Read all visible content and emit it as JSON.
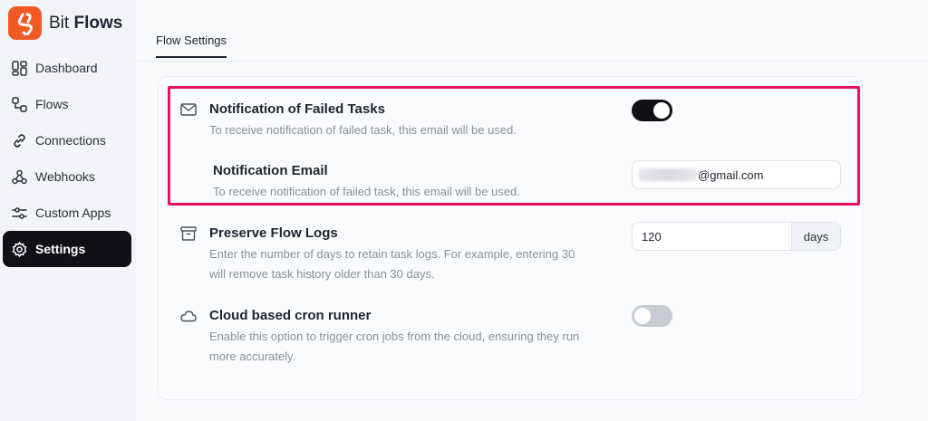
{
  "brand": {
    "name_light": "Bit",
    "name_bold": "Flows",
    "color": "#f15a24"
  },
  "sidebar": {
    "items": [
      {
        "label": "Dashboard",
        "icon": "dashboard-icon",
        "active": false
      },
      {
        "label": "Flows",
        "icon": "flows-icon",
        "active": false
      },
      {
        "label": "Connections",
        "icon": "link-icon",
        "active": false
      },
      {
        "label": "Webhooks",
        "icon": "webhook-icon",
        "active": false
      },
      {
        "label": "Custom Apps",
        "icon": "sliders-icon",
        "active": false
      },
      {
        "label": "Settings",
        "icon": "gear-icon",
        "active": true
      }
    ]
  },
  "tabs": [
    {
      "label": "Flow Settings",
      "active": true
    }
  ],
  "settings": {
    "failed_tasks": {
      "title": "Notification of Failed Tasks",
      "description": "To receive notification of failed task, this email will be used.",
      "icon": "mail-icon",
      "enabled": true
    },
    "notification_email": {
      "title": "Notification Email",
      "description": "To receive notification of failed task, this email will be used.",
      "value": "@gmail.com"
    },
    "preserve_logs": {
      "title": "Preserve Flow Logs",
      "description_line1": "Enter the number of days to retain task logs. For example, entering 30",
      "description_line2": "will remove task history older than 30 days.",
      "icon": "archive-icon",
      "value": "120",
      "unit": "days"
    },
    "cloud_cron": {
      "title": "Cloud based cron runner",
      "description_line1": "Enable this option to trigger cron jobs from the cloud, ensuring they run",
      "description_line2": "more accurately.",
      "icon": "cloud-icon",
      "enabled": false
    }
  },
  "colors": {
    "highlight": "#e5105f",
    "active_nav": "#0f1115",
    "toggle_on": "#0f1115",
    "toggle_off": "#c9ccd3"
  }
}
